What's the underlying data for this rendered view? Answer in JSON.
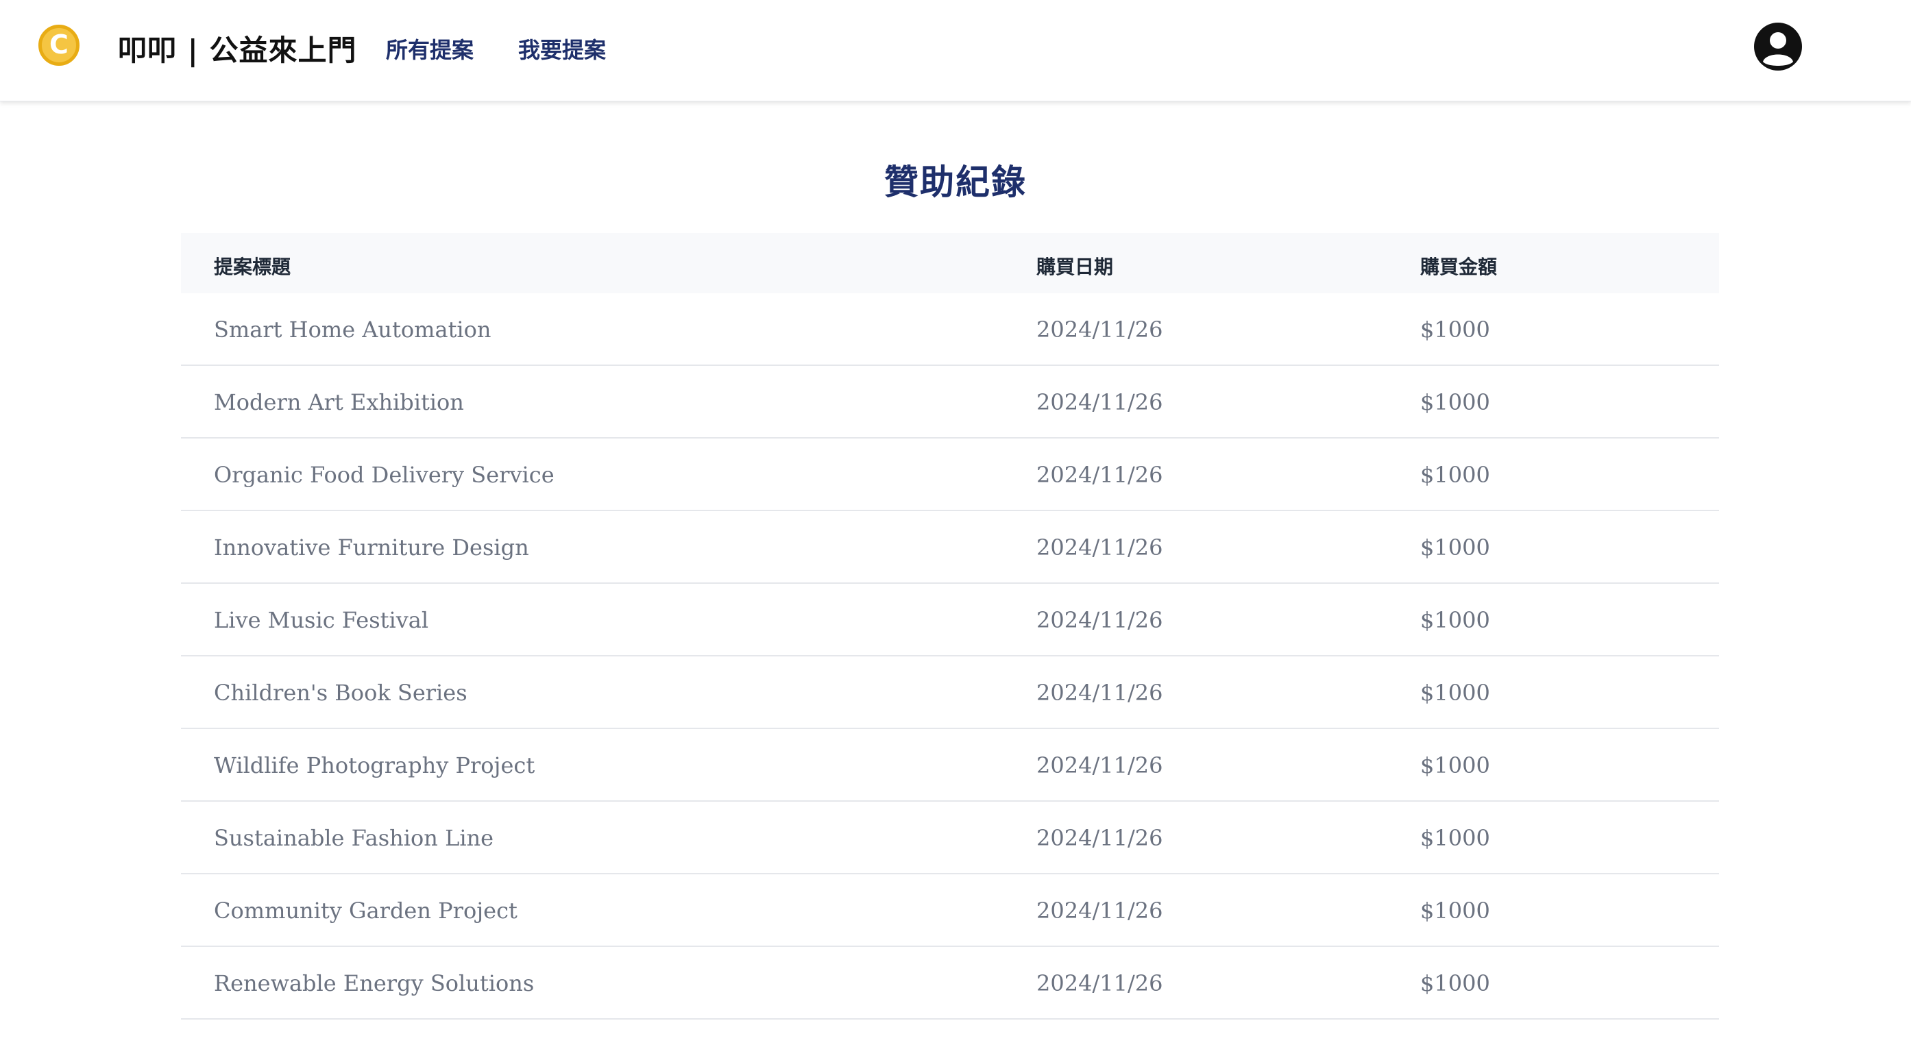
{
  "header": {
    "logo_glyph": "C",
    "brand": "叩叩 | 公益來上門",
    "nav": {
      "all_proposals": "所有提案",
      "i_want_to_propose": "我要提案"
    }
  },
  "colors": {
    "accent": "#1e2f6b",
    "logo_fill": "#f5c542",
    "logo_border": "#e8ac14",
    "header_bg": "#f8f9fb"
  },
  "main": {
    "title": "贊助紀錄",
    "table": {
      "columns": [
        "提案標題",
        "購買日期",
        "購買金額"
      ],
      "rows": [
        [
          "Smart Home Automation",
          "2024/11/26",
          "$1000"
        ],
        [
          "Modern Art Exhibition",
          "2024/11/26",
          "$1000"
        ],
        [
          "Organic Food Delivery Service",
          "2024/11/26",
          "$1000"
        ],
        [
          "Innovative Furniture Design",
          "2024/11/26",
          "$1000"
        ],
        [
          "Live Music Festival",
          "2024/11/26",
          "$1000"
        ],
        [
          "Children's Book Series",
          "2024/11/26",
          "$1000"
        ],
        [
          "Wildlife Photography Project",
          "2024/11/26",
          "$1000"
        ],
        [
          "Sustainable Fashion Line",
          "2024/11/26",
          "$1000"
        ],
        [
          "Community Garden Project",
          "2024/11/26",
          "$1000"
        ],
        [
          "Renewable Energy Solutions",
          "2024/11/26",
          "$1000"
        ]
      ]
    }
  }
}
